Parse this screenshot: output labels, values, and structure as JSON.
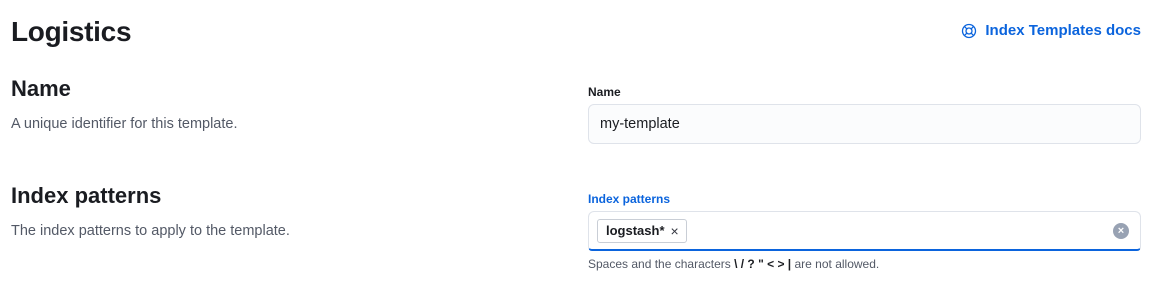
{
  "header": {
    "title": "Logistics",
    "docs_link": "Index Templates docs"
  },
  "name_section": {
    "title": "Name",
    "description": "A unique identifier for this template.",
    "field_label": "Name",
    "field_value": "my-template"
  },
  "patterns_section": {
    "title": "Index patterns",
    "description": "The index patterns to apply to the template.",
    "field_label": "Index patterns",
    "selected_patterns": [
      "logstash*"
    ],
    "remove_glyph": "×",
    "clear_glyph": "×",
    "help_prefix": "Spaces and the characters ",
    "help_chars": "\\ / ? \" < > |",
    "help_suffix": " are not allowed."
  },
  "icons": {
    "docs": "help-lifebuoy-icon",
    "remove": "close-icon",
    "clear": "clear-circle-icon"
  },
  "colors": {
    "accent": "#0b64dd",
    "text": "#1a1c21",
    "subdued": "#535966"
  }
}
